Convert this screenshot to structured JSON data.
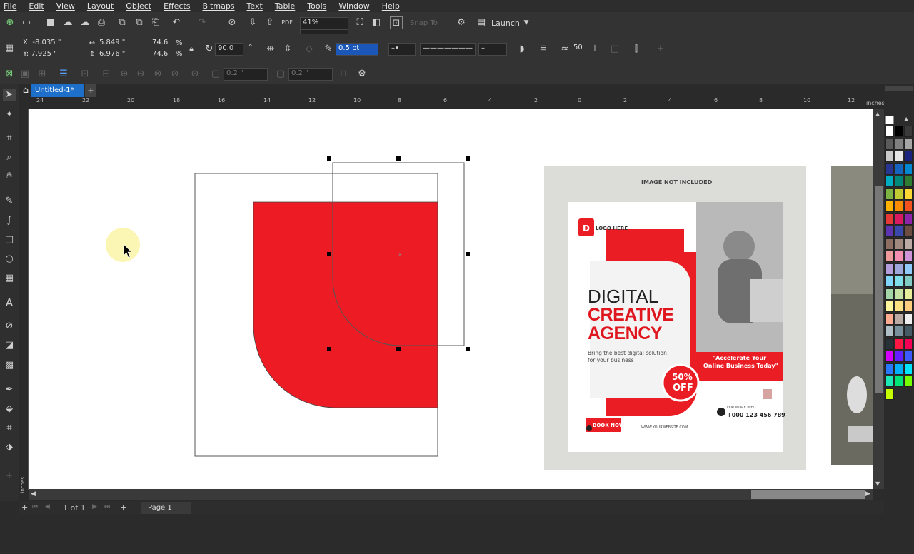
{
  "menu": [
    "File",
    "Edit",
    "View",
    "Layout",
    "Object",
    "Effects",
    "Bitmaps",
    "Text",
    "Table",
    "Tools",
    "Window",
    "Help"
  ],
  "toolbar": {
    "zoom": "41%",
    "snap_label": "Snap To",
    "launch_label": "Launch"
  },
  "property_bar": {
    "x": "X: -8.035 \"",
    "y": "Y: 7.925 \"",
    "width": "5.849 \"",
    "height": "6.976 \"",
    "scale_w": "74.6",
    "scale_h": "74.6",
    "percent": "%",
    "rotation": "90.0",
    "rotation_unit": "°",
    "outline_width": "0.5 pt",
    "smoothing": "50"
  },
  "align_bar": {
    "field1": "0.2 \"",
    "field2": "0.2 \""
  },
  "tabs": {
    "doc_title": "Untitled-1*",
    "add": "+"
  },
  "ruler": {
    "h_ticks": [
      "24",
      "22",
      "20",
      "18",
      "16",
      "14",
      "12",
      "10",
      "8",
      "6",
      "4",
      "2",
      "0",
      "2",
      "4",
      "6",
      "8",
      "10",
      "12"
    ],
    "unit": "inches",
    "v_unit": "inches"
  },
  "flyer": {
    "image_note": "IMAGE NOT INCLUDED",
    "logo_letter": "D",
    "logo_text": "LOGO HERE",
    "headline1": "DIGITAL",
    "headline2": "CREATIVE",
    "headline3": "AGENCY",
    "sub": "Bring the best digital  solution",
    "sub2": "for your business",
    "badge1": "50%",
    "badge2": "OFF",
    "quote1": "\"Accelerate Your",
    "quote2": "Online Business Today\"",
    "info_label": "FOR MORE INFO",
    "phone": "+000 123 456 789",
    "book": "BOOK NOW",
    "website": "WWW.YOURWEBSITE.COM"
  },
  "status": {
    "page_of": "1 of 1",
    "page_name": "Page 1"
  },
  "colors": {
    "accent_red": "#e8202a",
    "canvas": "#ffffff",
    "chrome": "#2d2d2d",
    "selection_tab": "#1e6fc9"
  },
  "palette": [
    "#ffffff",
    "#000000",
    "#3a3a3a",
    "#5b5b5b",
    "#808080",
    "#a6a6a6",
    "#c9c9c9",
    "#e6e6e6",
    "#1a237e",
    "#283593",
    "#1565c0",
    "#0288d1",
    "#00acc1",
    "#00897b",
    "#2e7d32",
    "#7cb342",
    "#c0ca33",
    "#fdd835",
    "#ffb300",
    "#fb8c00",
    "#f4511e",
    "#e53935",
    "#d81b60",
    "#8e24aa",
    "#5e35b1",
    "#3949ab",
    "#6d4c41",
    "#8d6e63",
    "#a1887f",
    "#bcaaa4",
    "#ef9a9a",
    "#f48fb1",
    "#ce93d8",
    "#b39ddb",
    "#9fa8da",
    "#90caf9",
    "#81d4fa",
    "#80deea",
    "#80cbc4",
    "#a5d6a7",
    "#c5e1a5",
    "#e6ee9c",
    "#fff59d",
    "#ffe082",
    "#ffcc80",
    "#ffab91",
    "#bcaaa4",
    "#eeeeee",
    "#b0bec5",
    "#78909c",
    "#455a64",
    "#263238",
    "#ff1744",
    "#f50057",
    "#d500f9",
    "#651fff",
    "#3d5afe",
    "#2979ff",
    "#00b0ff",
    "#00e5ff",
    "#1de9b6",
    "#00e676",
    "#76ff03",
    "#c6ff00"
  ]
}
